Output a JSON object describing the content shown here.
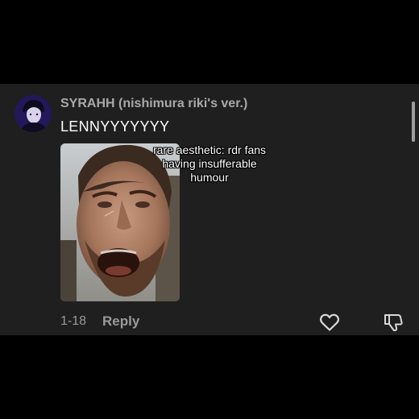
{
  "comment": {
    "username": "SYRAHH (nishimura riki's ver.)",
    "text": "LENNYYYYYYY",
    "media": {
      "caption_lines": [
        "rare aesthetic: rdr fans",
        "having insufferable",
        "humour"
      ]
    },
    "date": "1-18",
    "reply_label": "Reply",
    "icons": {
      "avatar": "avatar-image",
      "like": "heart-outline-icon",
      "dislike": "thumbs-down-outline-icon"
    }
  },
  "colors": {
    "background": "#000000",
    "card": "#1f1f1f",
    "username": "#a9a9a9",
    "text": "#ffffff",
    "muted": "#9a9a9a"
  }
}
